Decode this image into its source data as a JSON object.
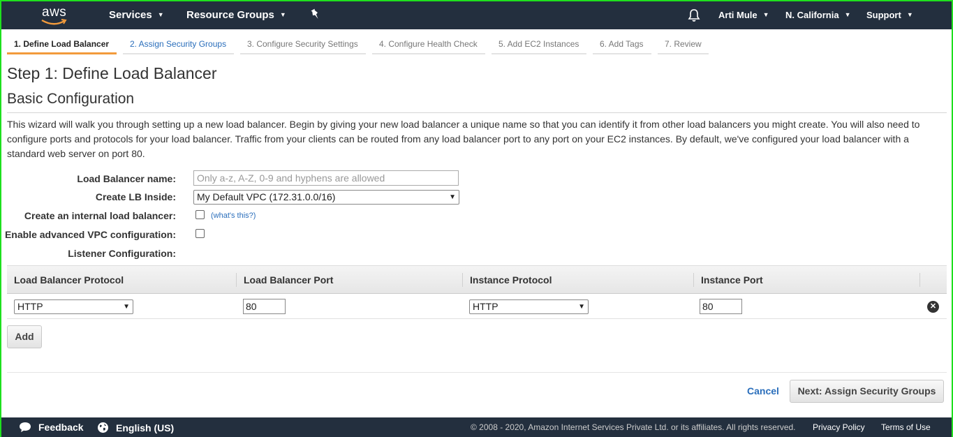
{
  "navbar": {
    "logo_text": "aws",
    "services": "Services",
    "resource_groups": "Resource Groups",
    "user": "Arti Mule",
    "region": "N. California",
    "support": "Support"
  },
  "tabs": [
    {
      "label": "1. Define Load Balancer",
      "state": "active"
    },
    {
      "label": "2. Assign Security Groups",
      "state": "link"
    },
    {
      "label": "3. Configure Security Settings",
      "state": "disabled"
    },
    {
      "label": "4. Configure Health Check",
      "state": "disabled"
    },
    {
      "label": "5. Add EC2 Instances",
      "state": "disabled"
    },
    {
      "label": "6. Add Tags",
      "state": "disabled"
    },
    {
      "label": "7. Review",
      "state": "disabled"
    }
  ],
  "page": {
    "step_title": "Step 1: Define Load Balancer",
    "section_title": "Basic Configuration",
    "intro": "This wizard will walk you through setting up a new load balancer. Begin by giving your new load balancer a unique name so that you can identify it from other load balancers you might create. You will also need to configure ports and protocols for your load balancer. Traffic from your clients can be routed from any load balancer port to any port on your EC2 instances. By default, we've configured your load balancer with a standard web server on port 80."
  },
  "form": {
    "name_label": "Load Balancer name:",
    "name_placeholder": "Only a-z, A-Z, 0-9 and hyphens are allowed",
    "name_value": "",
    "inside_label": "Create LB Inside:",
    "inside_value": "My Default VPC (172.31.0.0/16)",
    "internal_label": "Create an internal load balancer:",
    "internal_checked": false,
    "whats_this": "(what's this?)",
    "advanced_label": "Enable advanced VPC configuration:",
    "advanced_checked": false,
    "listener_label": "Listener Configuration:"
  },
  "listener_table": {
    "headers": [
      "Load Balancer Protocol",
      "Load Balancer Port",
      "Instance Protocol",
      "Instance Port"
    ],
    "rows": [
      {
        "lb_protocol": "HTTP",
        "lb_port": "80",
        "instance_protocol": "HTTP",
        "instance_port": "80"
      }
    ],
    "add_label": "Add"
  },
  "actions": {
    "cancel": "Cancel",
    "next": "Next: Assign Security Groups"
  },
  "footer": {
    "feedback": "Feedback",
    "language": "English (US)",
    "copyright": "© 2008 - 2020, Amazon Internet Services Private Ltd. or its affiliates. All rights reserved.",
    "privacy": "Privacy Policy",
    "terms": "Terms of Use"
  },
  "colors": {
    "navbar_bg": "#232f3e",
    "active_tab_underline": "#f29b3c",
    "link": "#2a6ebb",
    "window_border": "#1ee01e"
  },
  "icons": [
    "aws-logo",
    "pin-icon",
    "bell-icon",
    "chevron-down-icon",
    "remove-icon",
    "feedback-icon",
    "globe-icon"
  ]
}
